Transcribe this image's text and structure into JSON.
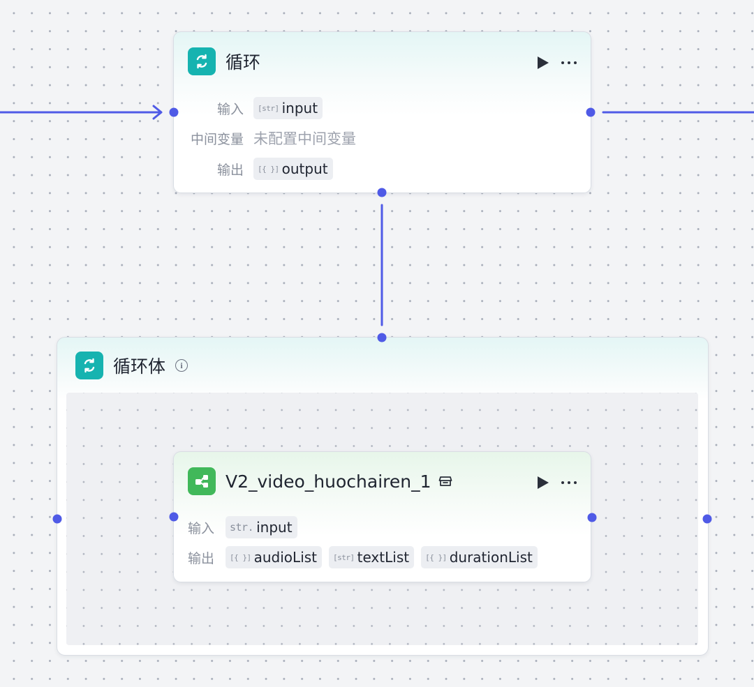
{
  "colors": {
    "edge": "#4f5ae6",
    "loop_icon_bg": "#16b3b0",
    "plugin_icon_bg": "#41b85a"
  },
  "loop_node": {
    "icon": "loop-icon",
    "title": "循环",
    "input_label": "输入",
    "input_var": {
      "type": "[str]",
      "name": "input"
    },
    "mid_label": "中间变量",
    "mid_value": "未配置中间变量",
    "output_label": "输出",
    "output_var": {
      "type": "[{ }]",
      "name": "output"
    }
  },
  "loop_body": {
    "icon": "loop-icon",
    "title": "循环体",
    "info_icon": "info-icon"
  },
  "plugin_node": {
    "icon": "plugin-icon",
    "title": "V2_video_huochairen_1",
    "store_icon": "store-icon",
    "input_label": "输入",
    "input_var": {
      "type": "str.",
      "name": "input"
    },
    "output_label": "输出",
    "outputs": [
      {
        "type": "[{ }]",
        "name": "audioList"
      },
      {
        "type": "[str]",
        "name": "textList"
      },
      {
        "type": "[{ }]",
        "name": "durationList"
      }
    ]
  }
}
